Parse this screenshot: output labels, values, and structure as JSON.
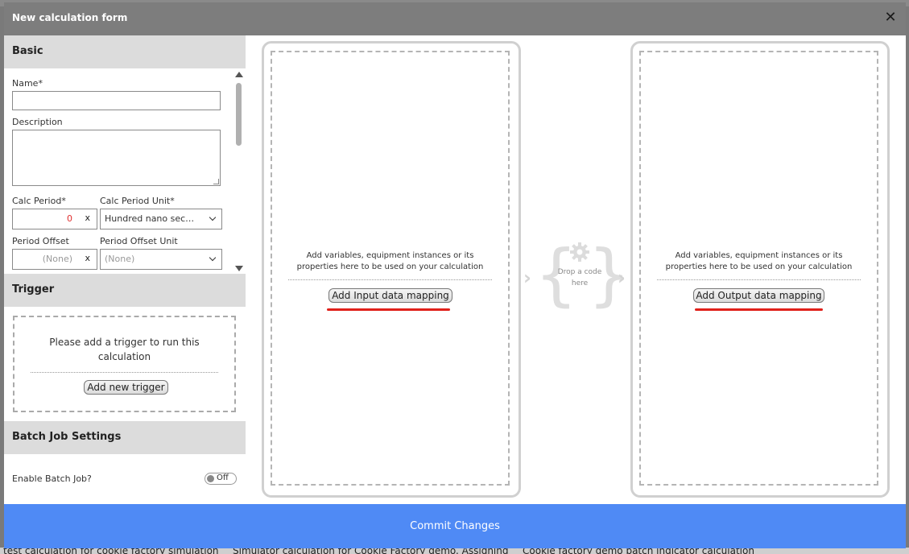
{
  "background": {
    "bottom_items": [
      "test calculation for cookie factory simulation",
      "Simulator calculation for Cookie Factory demo. Assigning",
      "Cookie factory demo batch indicator calculation"
    ]
  },
  "modal": {
    "title": "New calculation form",
    "close_icon": "close-icon"
  },
  "basic": {
    "heading": "Basic",
    "name_label": "Name*",
    "name_value": "",
    "description_label": "Description",
    "description_value": "",
    "calc_period_label": "Calc Period*",
    "calc_period_value": "0",
    "calc_period_clear": "x",
    "calc_period_unit_label": "Calc Period Unit*",
    "calc_period_unit_value": "Hundred nano sec…",
    "period_offset_label": "Period Offset",
    "period_offset_value": "(None)",
    "period_offset_clear": "x",
    "period_offset_unit_label": "Period Offset Unit",
    "period_offset_unit_value": "(None)"
  },
  "trigger": {
    "heading": "Trigger",
    "message": "Please add a trigger to run this calculation",
    "add_button": "Add new trigger"
  },
  "batch": {
    "heading": "Batch Job Settings",
    "enable_label": "Enable Batch Job?",
    "toggle_label": "Off"
  },
  "input_mapping": {
    "hint": "Add variables, equipment instances or its properties here to be used on your calculation",
    "button": "Add Input data mapping"
  },
  "code_drop": {
    "text": "Drop a code here",
    "icon": "gear-icon"
  },
  "output_mapping": {
    "hint": "Add variables, equipment instances or its properties here to be used on your calculation",
    "button": "Add Output data mapping"
  },
  "footer": {
    "commit_label": "Commit Changes"
  },
  "colors": {
    "accent": "#4f8af5",
    "underline": "#e0201a",
    "header": "#7d7d7d",
    "section": "#dcdcdc"
  }
}
